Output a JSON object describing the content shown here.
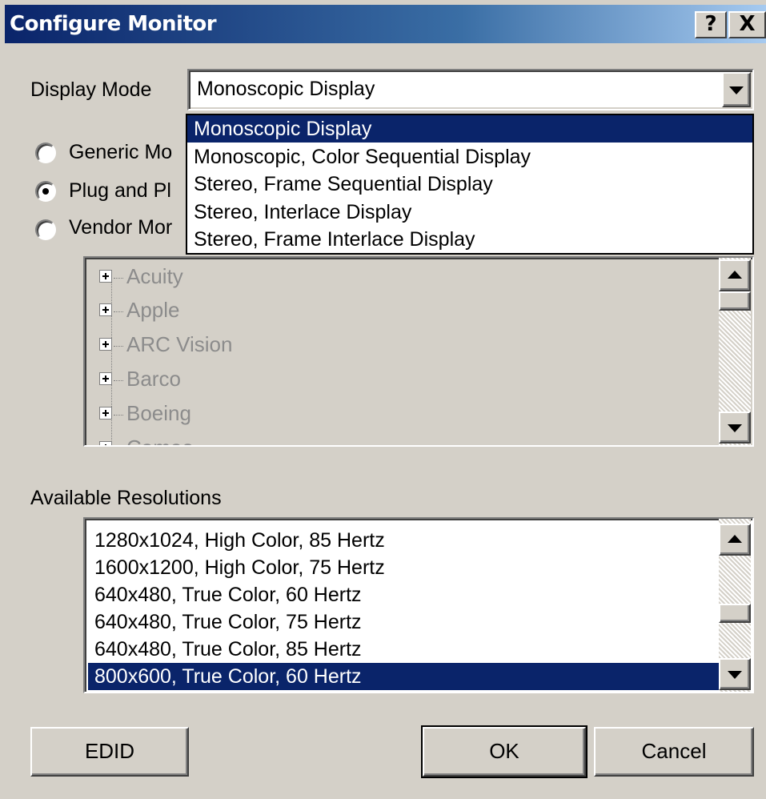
{
  "window": {
    "title": "Configure Monitor",
    "help_label": "?",
    "close_label": "X"
  },
  "display_mode": {
    "label": "Display Mode",
    "selected": "Monoscopic Display",
    "options": [
      "Monoscopic Display",
      "Monoscopic, Color Sequential Display",
      "Stereo, Frame Sequential Display",
      "Stereo, Interlace Display",
      "Stereo, Frame Interlace Display"
    ],
    "selected_index": 0
  },
  "monitor_type": {
    "options": [
      {
        "label": "Generic Mo",
        "checked": false
      },
      {
        "label": "Plug and Pl",
        "checked": true
      },
      {
        "label": "Vendor Mor",
        "checked": false
      }
    ]
  },
  "vendor_tree": {
    "items": [
      "Acuity",
      "Apple",
      "ARC Vision",
      "Barco",
      "Boeing",
      "Cameo"
    ],
    "enabled": false
  },
  "resolutions": {
    "label": "Available Resolutions",
    "items": [
      "1280x1024, High Color, 85 Hertz",
      "1600x1200, High Color, 75 Hertz",
      "640x480, True Color, 60 Hertz",
      "640x480, True Color, 75 Hertz",
      "640x480, True Color, 85 Hertz",
      "800x600, True Color, 60 Hertz"
    ],
    "selected_index": 5
  },
  "buttons": {
    "edid": "EDID",
    "ok": "OK",
    "cancel": "Cancel"
  }
}
